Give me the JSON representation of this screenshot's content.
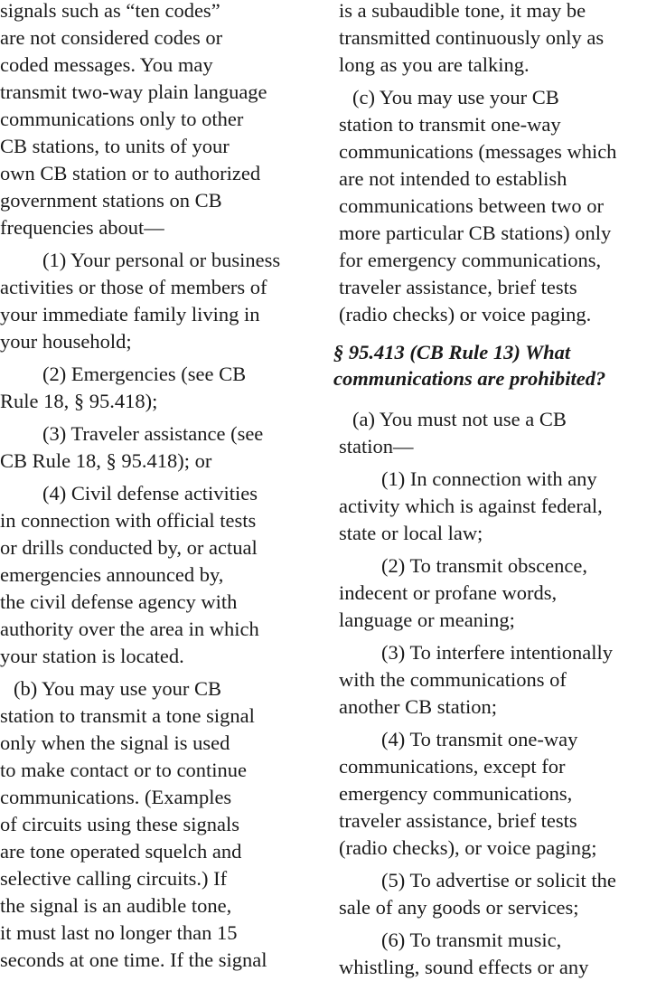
{
  "document": {
    "left_column": {
      "intro_paragraph": [
        "signals such as “ten codes”",
        "are not considered codes or",
        "coded messages. You may",
        "transmit two-way plain language",
        "communications only to other",
        "CB stations, to units of your",
        "own CB station or to authorized",
        "government stations on CB",
        "frequencies about—"
      ],
      "item_1": [
        "(1) Your personal or business",
        "activities or those of members of",
        "your immediate family living in",
        "your household;"
      ],
      "item_2": [
        "(2) Emergencies (see CB",
        "Rule 18, § 95.418);"
      ],
      "item_3": [
        "(3) Traveler assistance (see",
        "CB Rule 18, § 95.418); or"
      ],
      "item_4": [
        "(4) Civil defense activities",
        "in connection with official tests",
        "or drills conducted by, or actual",
        "emergencies announced by,",
        "the civil defense agency with",
        "authority over the area in which",
        "your station is located."
      ],
      "paragraph_b": [
        "(b) You may use your CB",
        "station to transmit a tone signal",
        "only when the signal is used",
        "to make contact or to continue",
        "communications. (Examples",
        "of circuits using these signals",
        "are tone operated squelch and",
        "selective calling circuits.) If",
        "the signal is an audible tone,",
        "it must last no longer than 15",
        "seconds at one time. If the signal"
      ]
    },
    "right_column": {
      "paragraph_b_continued": [
        "is a subaudible tone, it may be",
        "transmitted continuously only as",
        "long as you are talking."
      ],
      "paragraph_c": [
        "(c) You may use your CB",
        "station to transmit one-way",
        "communications (messages which",
        "are not intended to establish",
        "communications between two or",
        "more particular CB stations) only",
        "for emergency communications,",
        "traveler assistance, brief tests",
        "(radio checks) or voice paging."
      ],
      "section_heading": [
        "§ 95.413 (CB Rule 13) What",
        "communications are prohibited?"
      ],
      "paragraph_a": [
        "(a) You must not use a CB",
        "station—"
      ],
      "prohibited_1": [
        "(1) In connection with any",
        "activity which is against federal,",
        "state or local law;"
      ],
      "prohibited_2": [
        "(2) To transmit obscence,",
        "indecent or profane words,",
        "language or meaning;"
      ],
      "prohibited_3": [
        "(3) To interfere intentionally",
        "with the communications of",
        "another CB station;"
      ],
      "prohibited_4": [
        "(4) To transmit one-way",
        "communications, except for",
        "emergency communications,",
        "traveler assistance, brief tests",
        "(radio checks), or voice paging;"
      ],
      "prohibited_5": [
        "(5) To advertise or solicit the",
        "sale of any goods or services;"
      ],
      "prohibited_6": [
        "(6) To transmit music,",
        "whistling, sound effects or any"
      ]
    }
  }
}
